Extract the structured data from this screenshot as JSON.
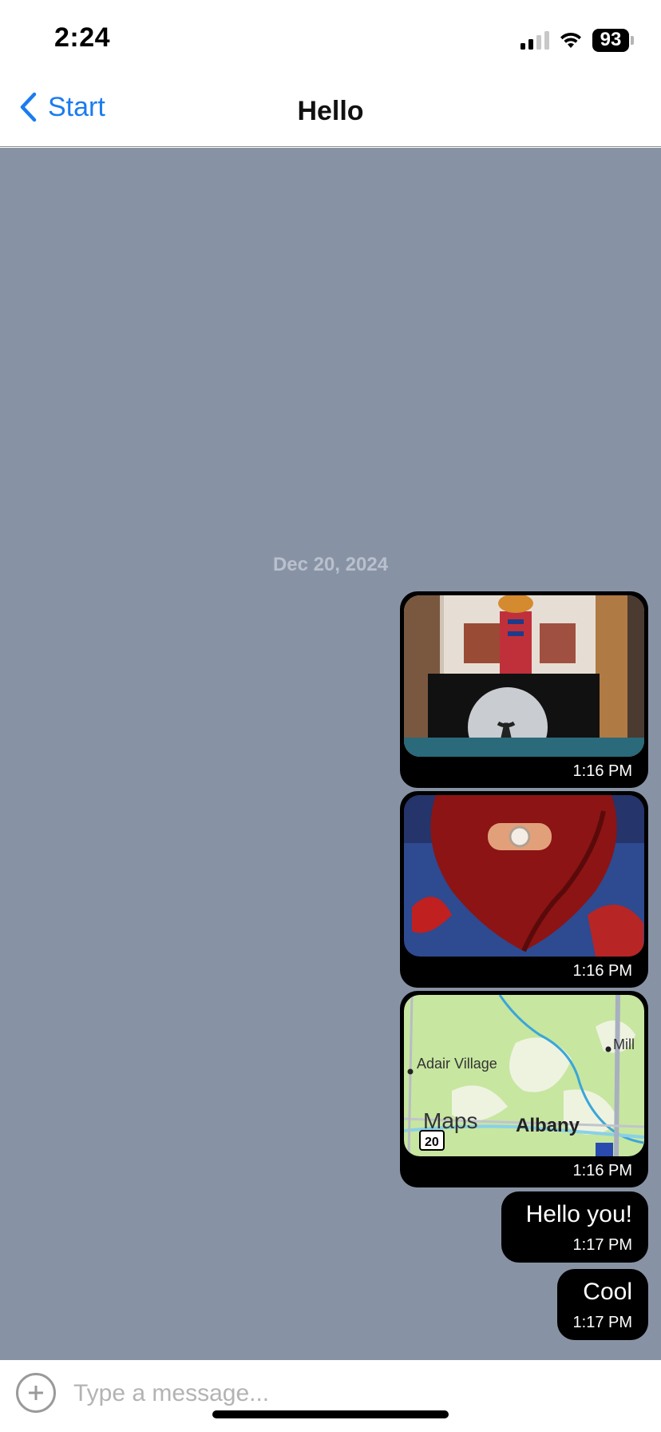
{
  "status_bar": {
    "time": "2:24",
    "battery": "93"
  },
  "nav": {
    "back_label": "Start",
    "title": "Hello"
  },
  "chat": {
    "date_separator": "Dec 20, 2024",
    "messages": [
      {
        "kind": "image",
        "image_desc": "painting-photo",
        "time": "1:16 PM"
      },
      {
        "kind": "image",
        "image_desc": "heart-painting-photo",
        "time": "1:16 PM"
      },
      {
        "kind": "map",
        "time": "1:16 PM",
        "map": {
          "place_1": "Adair Village",
          "place_2": "Mill",
          "city": "Albany",
          "brand": "Maps",
          "route_shield": "20"
        }
      },
      {
        "kind": "text",
        "text": "Hello you!",
        "time": "1:17 PM"
      },
      {
        "kind": "text",
        "text": "Cool",
        "time": "1:17 PM"
      }
    ]
  },
  "input": {
    "placeholder": "Type a message..."
  },
  "colors": {
    "accent": "#1a7cf0",
    "chat_bg": "#8793a5",
    "bubble": "#000000"
  }
}
